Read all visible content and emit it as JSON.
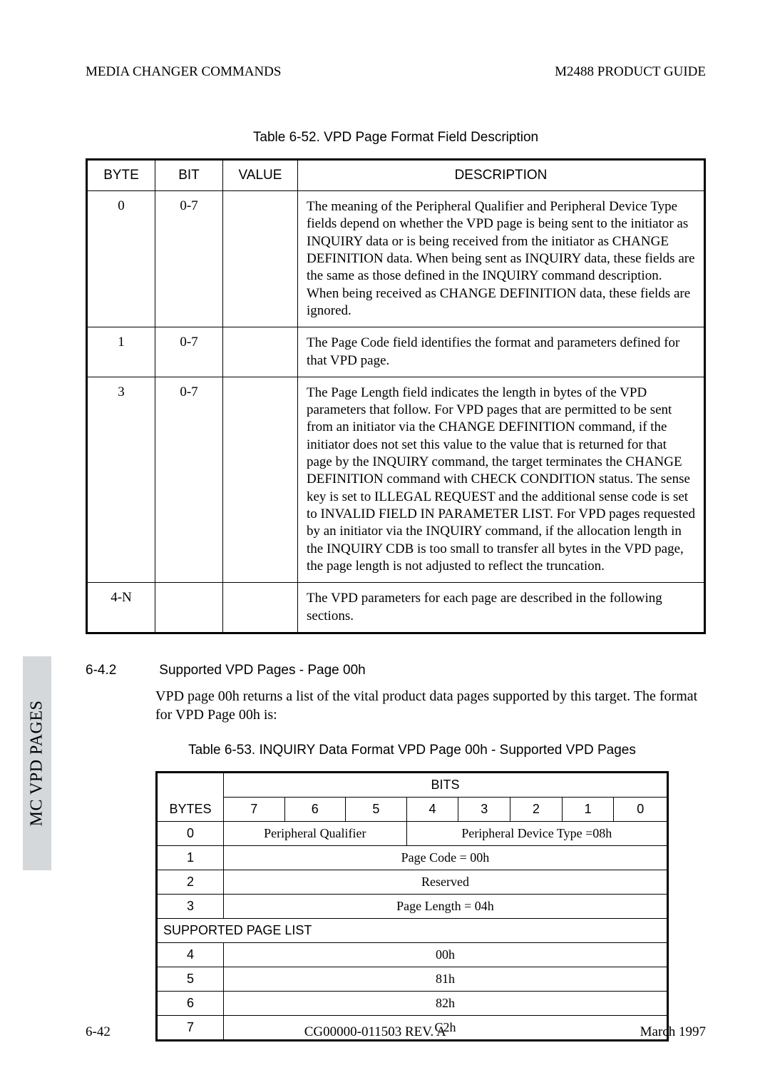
{
  "header": {
    "left": "MEDIA CHANGER COMMANDS",
    "right": "M2488 PRODUCT GUIDE"
  },
  "table_6_52": {
    "caption": "Table 6-52.   VPD Page Format Field Description",
    "cols": [
      "BYTE",
      "BIT",
      "VALUE",
      "DESCRIPTION"
    ],
    "rows": [
      {
        "byte": "0",
        "bit": "0-7",
        "value": "",
        "desc": "The meaning of the Peripheral Qualifier and Peripheral Device Type fields depend on whether the VPD page is being sent to the initiator as INQUIRY data or is being received from the initiator as CHANGE DEFINITION data.  When being sent as INQUIRY data, these fields are the same as those defined in the INQUIRY command description.  When being received as CHANGE DEFINITION data, these fields are ignored."
      },
      {
        "byte": "1",
        "bit": "0-7",
        "value": "",
        "desc": "The Page Code field identifies the format and parameters defined for that VPD page."
      },
      {
        "byte": "3",
        "bit": "0-7",
        "value": "",
        "desc": "The Page Length field indicates the length in bytes of the VPD parameters that follow.  For VPD pages that are permitted to be sent from an initiator via the CHANGE DEFINITION command, if the initiator does not set this value to the value that is returned for that page by the INQUIRY command, the target terminates the CHANGE DEFINITION command with CHECK CONDITION status. The sense key is set to ILLEGAL REQUEST and the additional sense code is set to INVALID FIELD IN PARAMETER LIST.  For VPD pages requested by an initiator via the INQUIRY command, if the allocation length in the INQUIRY CDB is too small to transfer all bytes in the VPD page, the page length is not adjusted to reflect the truncation."
      },
      {
        "byte": "4-N",
        "bit": "",
        "value": "",
        "desc": "The VPD parameters for each page are described in the following sections."
      }
    ]
  },
  "section_6_4_2": {
    "num": "6-4.2",
    "title": "Supported VPD Pages - Page 00h",
    "body": "VPD page 00h returns a list of the vital product data pages supported by this target. The format for VPD Page 00h is:"
  },
  "table_6_53": {
    "caption": "Table 6-53.   INQUIRY Data Format VPD Page 00h - Supported VPD Pages",
    "bits_heading": "BITS",
    "bytes_heading": "BYTES",
    "bit_cols": [
      "7",
      "6",
      "5",
      "4",
      "3",
      "2",
      "1",
      "0"
    ],
    "row0": {
      "byte": "0",
      "left": "Peripheral Qualifier",
      "right": "Peripheral Device Type =08h"
    },
    "row1": {
      "byte": "1",
      "txt": "Page Code = 00h"
    },
    "row2": {
      "byte": "2",
      "txt": "Reserved"
    },
    "row3": {
      "byte": "3",
      "txt": "Page Length = 04h"
    },
    "spl": "SUPPORTED PAGE LIST",
    "list": [
      {
        "byte": "4",
        "txt": "00h"
      },
      {
        "byte": "5",
        "txt": "81h"
      },
      {
        "byte": "6",
        "txt": "82h"
      },
      {
        "byte": "7",
        "txt": "C2h"
      }
    ]
  },
  "side_tab": "MC VPD PAGES",
  "footer": {
    "left": "6-42",
    "center": "CG00000-011503 REV. A",
    "right": "March 1997"
  }
}
